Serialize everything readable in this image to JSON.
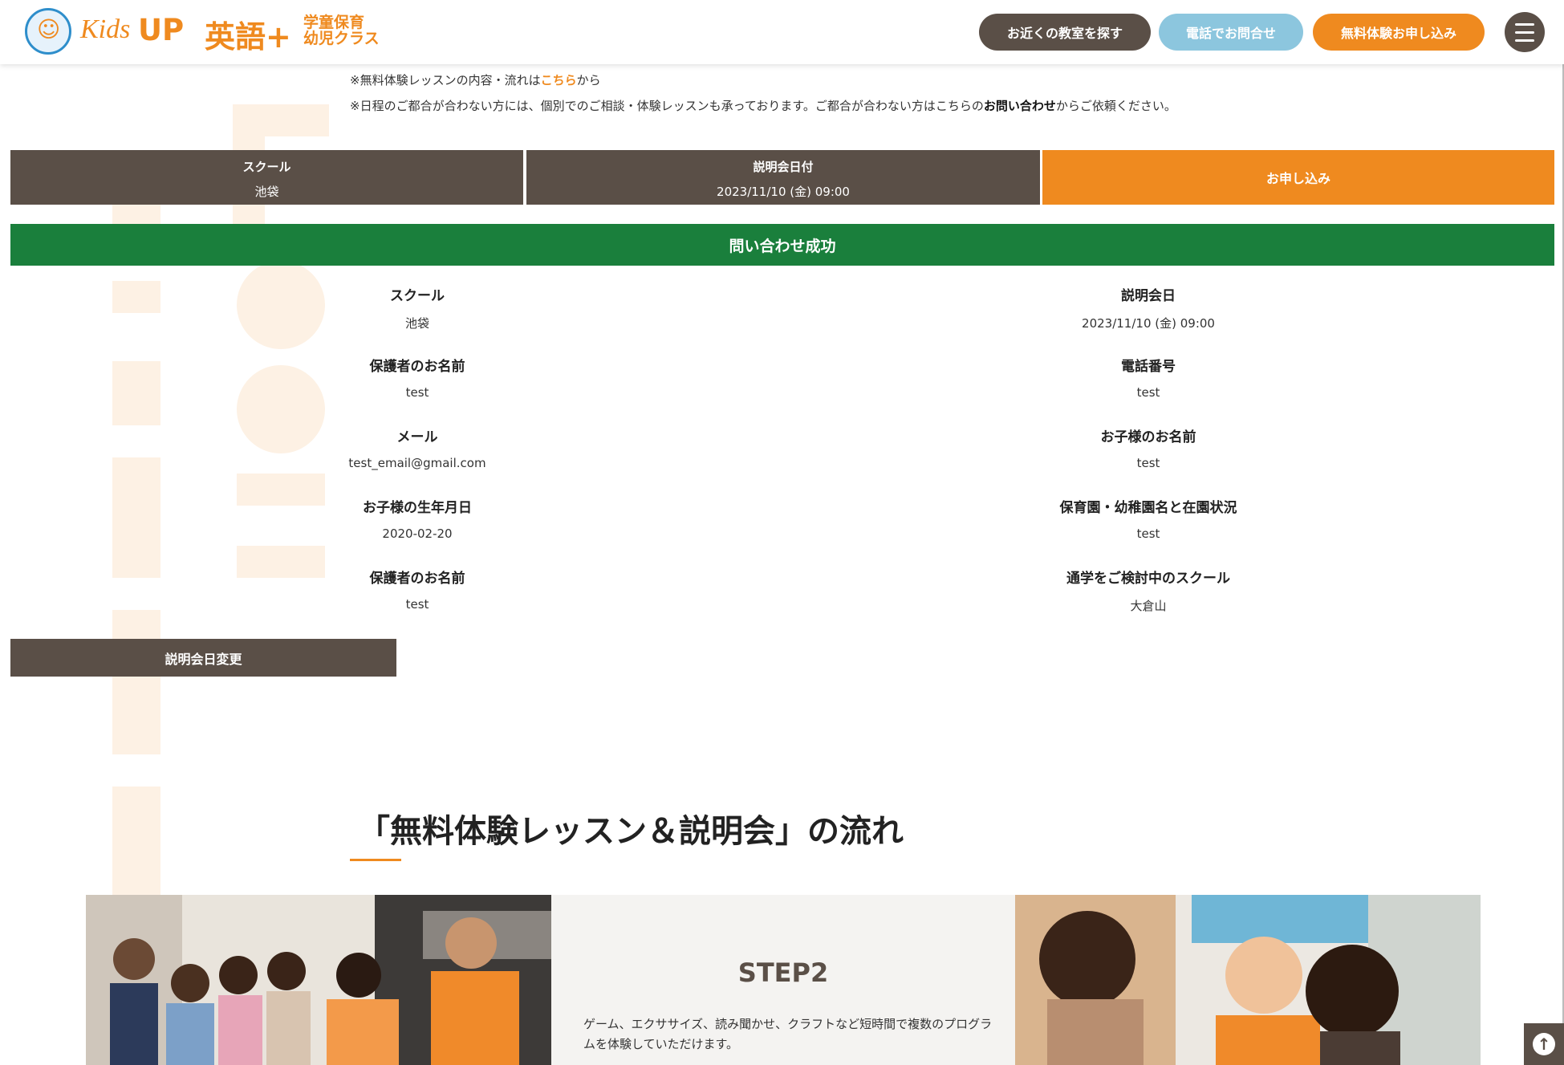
{
  "header": {
    "logo_kids": "Kids",
    "logo_up": "UP",
    "logo_eigo": "英語+",
    "logo_sub": "学童保育 幼児クラス",
    "nearby_button": "お近くの教室を探す",
    "phone_button": "電話でお問合せ",
    "trial_button": "無料体験お申し込み"
  },
  "notes": {
    "line1_prefix": "※無料体験レッスンの内容・流れは",
    "line1_link": "こちら",
    "line1_suffix": "から",
    "line2_prefix": "※日程のご都合が合わない方には、個別でのご相談・体験レッスンも承っております。ご都合が合わない方はこちらの",
    "line2_bold": "お問い合わせ",
    "line2_suffix": "からご依頼ください。"
  },
  "summary": {
    "school_label": "スクール",
    "school_value": "池袋",
    "date_label": "説明会日付",
    "date_value": "2023/11/10 (金) 09:00",
    "apply_button": "お申し込み"
  },
  "success_banner": "問い合わせ成功",
  "details": {
    "left": [
      {
        "label": "スクール",
        "value": "池袋"
      },
      {
        "label": "保護者のお名前",
        "value": "test"
      },
      {
        "label": "メール",
        "value": "test_email@gmail.com"
      },
      {
        "label": "お子様の生年月日",
        "value": "2020-02-20"
      },
      {
        "label": "保護者のお名前",
        "value": "test"
      }
    ],
    "right": [
      {
        "label": "説明会日",
        "value": "2023/11/10 (金) 09:00"
      },
      {
        "label": "電話番号",
        "value": "test"
      },
      {
        "label": "お子様のお名前",
        "value": "test"
      },
      {
        "label": "保育園・幼稚園名と在園状況",
        "value": "test"
      },
      {
        "label": "通学をご検討中のスクール",
        "value": "大倉山"
      }
    ]
  },
  "change_button": "説明会日変更",
  "flow": {
    "title": "「無料体験レッスン＆説明会」の流れ",
    "step_label": "STEP2",
    "step_desc": "ゲーム、エクササイズ、読み聞かせ、クラフトなど短時間で複数のプログラムを体験していただけます。"
  },
  "icons": {
    "menu": "hamburger-icon",
    "scroll_top": "arrow-up-circle-icon"
  },
  "colors": {
    "brand_orange": "#ef8a1f",
    "dark_brown": "#5a4f47",
    "light_blue": "#8cc6de",
    "success_green": "#1a7f3c"
  }
}
